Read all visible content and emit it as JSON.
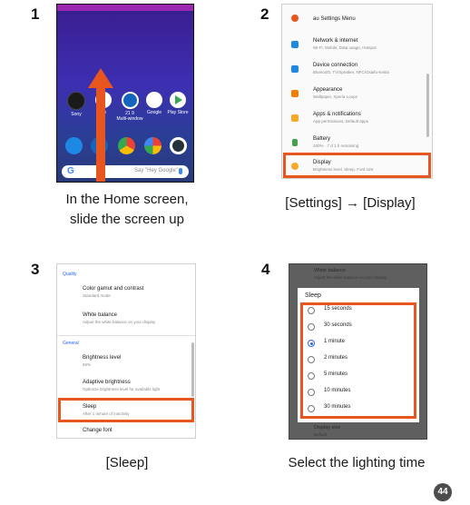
{
  "steps": [
    {
      "number": "1",
      "caption_line1": "In the Home screen,",
      "caption_line2": "slide the screen up"
    },
    {
      "number": "2",
      "caption": "[Settings] → [Display]"
    },
    {
      "number": "3",
      "caption": "[Sleep]"
    },
    {
      "number": "4",
      "caption": "Select the lighting time"
    }
  ],
  "home": {
    "apps": [
      {
        "label": "Sony",
        "color": "#1a1a1a",
        "icon": "sony-folder-icon"
      },
      {
        "label": "au",
        "color": "#ffffff",
        "icon": "au-folder-icon"
      },
      {
        "label": "21 9\nMulti-window",
        "color": "#1565c0",
        "icon": "multi-window-icon"
      },
      {
        "label": "Google",
        "color": "#ffffff",
        "icon": "google-folder-icon"
      },
      {
        "label": "Play Store",
        "color": "#ffffff",
        "icon": "play-store-icon"
      }
    ],
    "dock": [
      {
        "color": "#1e88e5",
        "icon": "phone-icon"
      },
      {
        "color": "#1565c0",
        "icon": "messages-icon"
      },
      {
        "color": "#f4b400",
        "icon": "chrome-icon"
      },
      {
        "color": "#ffffff",
        "icon": "photos-icon"
      },
      {
        "color": "#263238",
        "icon": "camera-icon"
      }
    ],
    "search_glyph": "G",
    "search_placeholder": "Say \"Hey Google\""
  },
  "settings_menu": {
    "items": [
      {
        "title": "au Settings Menu",
        "subtitle": "",
        "color": "#e8561f",
        "icon": "au-settings-icon"
      },
      {
        "title": "Network & internet",
        "subtitle": "Wi-Fi, Mobile, Data usage, Hotspot",
        "color": "#1e88e5",
        "icon": "wifi-icon"
      },
      {
        "title": "Device connection",
        "subtitle": "Bluetooth, TV/Speaker, NFC/Osaifu-Keitai",
        "color": "#1e88e5",
        "icon": "device-connection-icon"
      },
      {
        "title": "Appearance",
        "subtitle": "Wallpaper, Xperia Loops",
        "color": "#f57c00",
        "icon": "appearance-icon"
      },
      {
        "title": "Apps & notifications",
        "subtitle": "App permissions, Default apps",
        "color": "#f9a825",
        "icon": "apps-icon"
      },
      {
        "title": "Battery",
        "subtitle": "100% · 7 d 1 h remaining",
        "color": "#43a047",
        "icon": "battery-icon"
      },
      {
        "title": "Display",
        "subtitle": "Brightness level, Sleep, Font size",
        "color": "#f9a825",
        "icon": "display-icon"
      }
    ]
  },
  "display_settings": {
    "sections": {
      "quality": "Quality",
      "general": "General"
    },
    "items": [
      {
        "title": "Color gamut and contrast",
        "subtitle": "Standard mode"
      },
      {
        "title": "White balance",
        "subtitle": "Adjust the white balance on your display"
      },
      {
        "title": "Brightness level",
        "subtitle": "65%"
      },
      {
        "title": "Adaptive brightness",
        "subtitle": "Optimize brightness level for available light"
      },
      {
        "title": "Sleep",
        "subtitle": "After 1 minute of inactivity"
      },
      {
        "title": "Change font",
        "subtitle": ""
      }
    ]
  },
  "sleep_dialog": {
    "background_top_title": "White balance",
    "background_top_subtitle": "Adjust the white balance on your display",
    "title": "Sleep",
    "options": [
      "15 seconds",
      "30 seconds",
      "1 minute",
      "2 minutes",
      "5 minutes",
      "10 minutes",
      "30 minutes"
    ],
    "selected": "1 minute",
    "background_bottom_title": "Display size",
    "background_bottom_subtitle": "Default"
  },
  "page_number": "44",
  "colors": {
    "highlight": "#e8561f",
    "link_blue": "#2962ff",
    "radio_selected": "#3367d6"
  }
}
